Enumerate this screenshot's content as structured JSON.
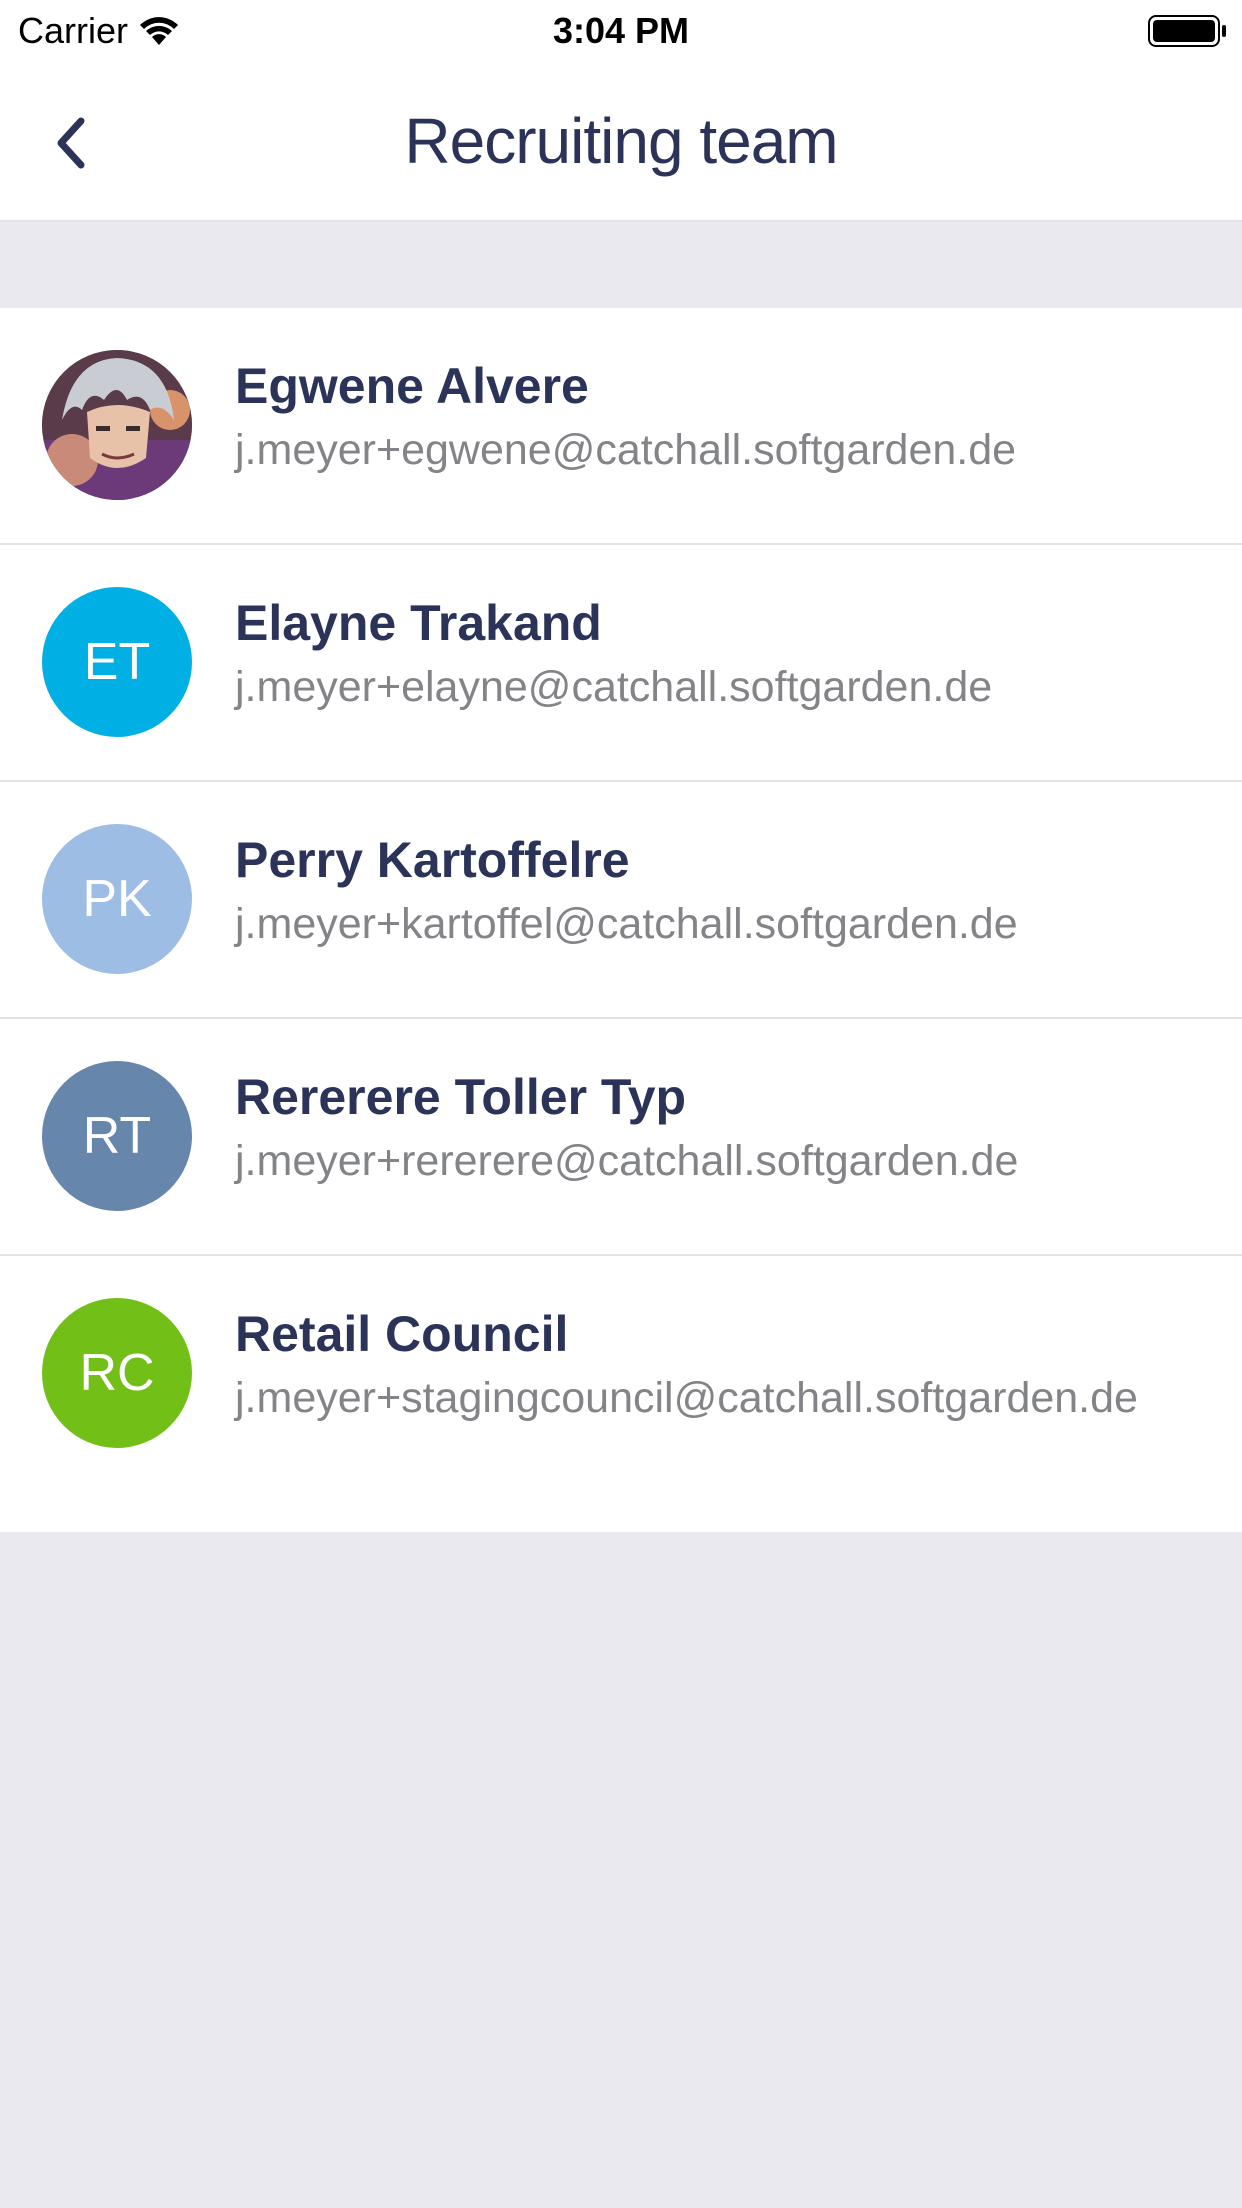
{
  "status_bar": {
    "carrier": "Carrier",
    "time": "3:04 PM",
    "icons": [
      "wifi-icon",
      "battery-icon"
    ]
  },
  "nav": {
    "title": "Recruiting team",
    "back_icon": "chevron-left-icon"
  },
  "colors": {
    "title": "#2b3458",
    "email": "#828488",
    "background": "#e9e9ef"
  },
  "members": [
    {
      "name": "Egwene Alvere",
      "email": "j.meyer+egwene@catchall.softgarden.de",
      "initials": "",
      "avatar_color": "#6b4b5a",
      "has_photo": true
    },
    {
      "name": "Elayne Trakand",
      "email": "j.meyer+elayne@catchall.softgarden.de",
      "initials": "ET",
      "avatar_color": "#00afe3"
    },
    {
      "name": "Perry Kartoffelre",
      "email": "j.meyer+kartoffel@catchall.softgarden.de",
      "initials": "PK",
      "avatar_color": "#9dbde5"
    },
    {
      "name": "Rererere Toller Typ",
      "email": "j.meyer+rererere@catchall.softgarden.de",
      "initials": "RT",
      "avatar_color": "#6786ab"
    },
    {
      "name": "Retail Council",
      "email": "j.meyer+stagingcouncil@catchall.softgarden.de",
      "initials": "RC",
      "avatar_color": "#72bf18"
    }
  ]
}
